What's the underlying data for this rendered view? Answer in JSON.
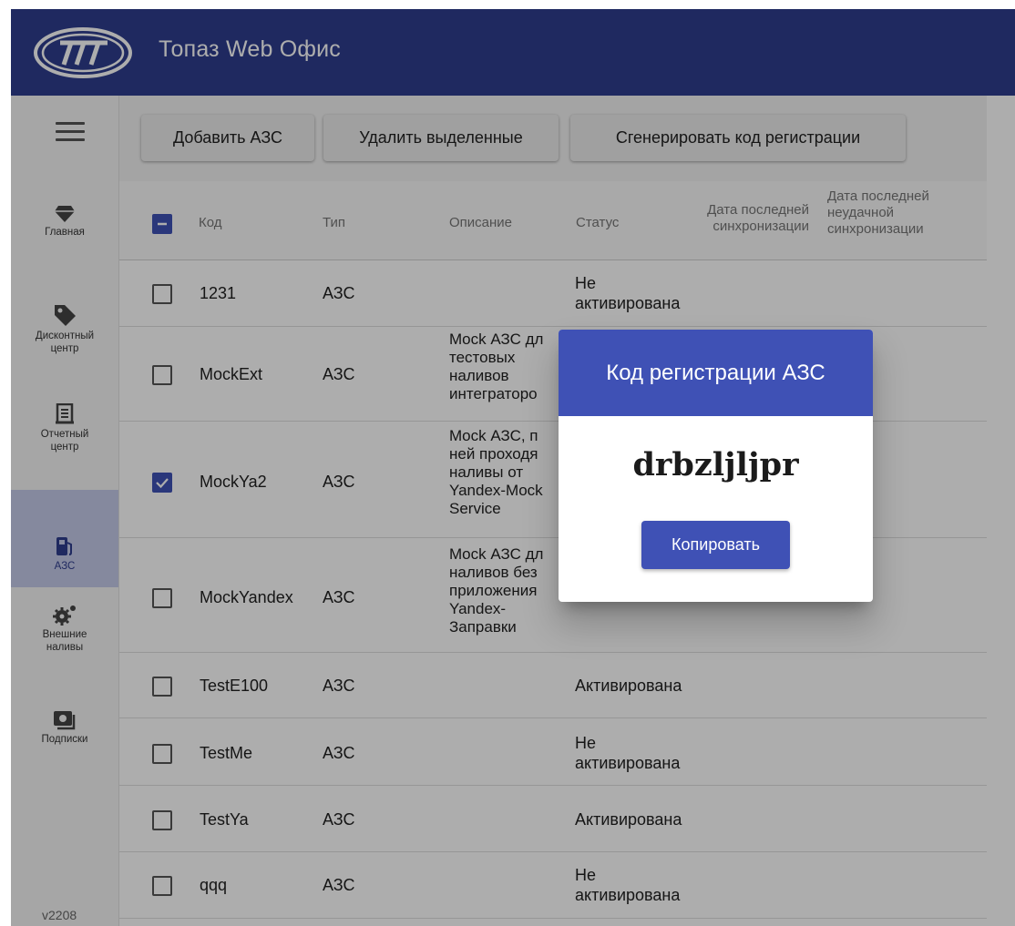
{
  "header": {
    "title": "Топаз Web Офис",
    "logo": "topaz-logo"
  },
  "sidebar": {
    "items": [
      {
        "label": "Главная",
        "icon": "diamond-icon"
      },
      {
        "label": "Дисконтный центр",
        "icon": "tag-icon"
      },
      {
        "label": "Отчетный центр",
        "icon": "report-icon"
      },
      {
        "label": "АЗС",
        "icon": "fuel-pump-icon",
        "active": true
      },
      {
        "label": "Внешние наливы",
        "icon": "gears-icon"
      },
      {
        "label": "Подписки",
        "icon": "subscription-icon"
      }
    ],
    "version": "v2208"
  },
  "toolbar": {
    "add_label": "Добавить АЗС",
    "delete_label": "Удалить выделенные",
    "generate_label": "Сгенерировать код регистрации"
  },
  "table": {
    "headers": {
      "code": "Код",
      "type": "Тип",
      "description": "Описание",
      "status": "Статус",
      "last_sync": "Дата последней синхронизации",
      "last_failed_sync": "Дата последней неудачной синхронизации"
    },
    "rows": [
      {
        "code": "1231",
        "type": "АЗС",
        "description": "",
        "status": "Не активирована",
        "checked": false
      },
      {
        "code": "MockExt",
        "type": "АЗС",
        "description": "Mock АЗС дл тестовых наливов интеграторо",
        "status": "",
        "checked": false
      },
      {
        "code": "MockYa2",
        "type": "АЗС",
        "description": "Mock АЗС, п ней проходя наливы от Yandex-Mock Service",
        "status": "",
        "checked": true
      },
      {
        "code": "MockYandex",
        "type": "АЗС",
        "description": "Mock АЗС дл наливов без приложения Yandex-Заправки",
        "status": "",
        "checked": false
      },
      {
        "code": "TestE100",
        "type": "АЗС",
        "description": "",
        "status": "Активирована",
        "checked": false
      },
      {
        "code": "TestMe",
        "type": "АЗС",
        "description": "",
        "status": "Не активирована",
        "checked": false
      },
      {
        "code": "TestYa",
        "type": "АЗС",
        "description": "",
        "status": "Активирована",
        "checked": false
      },
      {
        "code": "qqq",
        "type": "АЗС",
        "description": "",
        "status": "Не активирована",
        "checked": false
      }
    ]
  },
  "dialog": {
    "title": "Код регистрации АЗС",
    "code": "drbzljljpr",
    "copy_label": "Копировать"
  },
  "colors": {
    "header": "#2e3d8e",
    "primary": "#3f51b5",
    "active_nav": "#c5cae9"
  }
}
